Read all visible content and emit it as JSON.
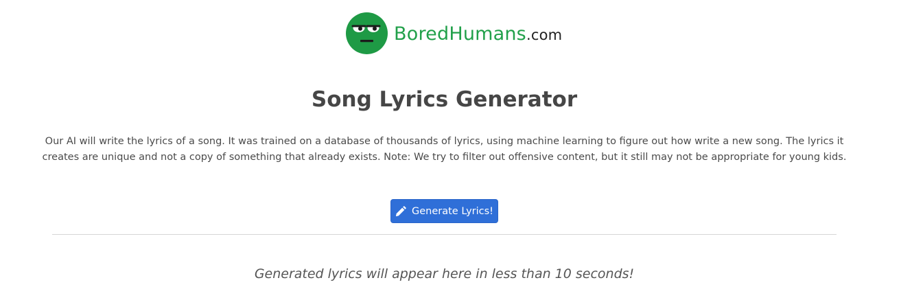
{
  "logo": {
    "brand_first": "Bored",
    "brand_second": "Humans",
    "tld": ".com",
    "icon": "bored-face-icon",
    "brand_color": "#21a04a"
  },
  "main": {
    "title": "Song Lyrics Generator",
    "description": "Our AI will write the lyrics of a song. It was trained on a database of thousands of lyrics, using machine learning to figure out how write a new song. The lyrics it creates are unique and not a copy of something that already exists. Note: We try to filter out offensive content, but it still may not be appropriate for young kids.",
    "generate_button": {
      "label": "Generate Lyrics!",
      "icon": "pencil-icon",
      "color": "#2f6fd8"
    },
    "output_placeholder": "Generated lyrics will appear here in less than 10 seconds!"
  }
}
